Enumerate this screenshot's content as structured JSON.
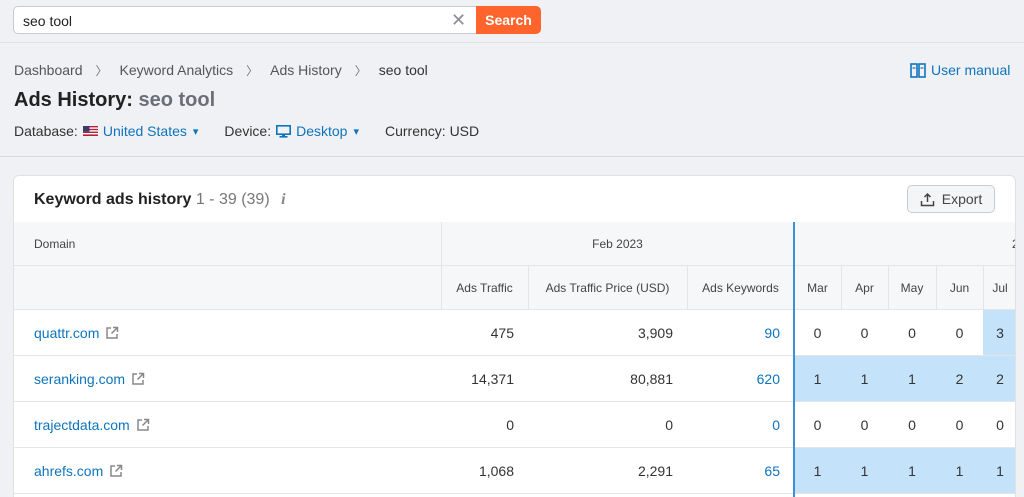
{
  "search": {
    "value": "seo tool",
    "button_label": "Search"
  },
  "breadcrumb": {
    "items": [
      "Dashboard",
      "Keyword Analytics",
      "Ads History"
    ],
    "current": "seo tool"
  },
  "user_manual_label": "User manual",
  "title": {
    "main": "Ads History:",
    "query": "seo tool"
  },
  "filters": {
    "database_label": "Database:",
    "database_value": "United States",
    "device_label": "Device:",
    "device_value": "Desktop",
    "currency_label": "Currency: USD"
  },
  "card": {
    "title": "Keyword ads history",
    "count": "1 - 39 (39)",
    "info_icon": "i",
    "export_label": "Export"
  },
  "table": {
    "domain_header": "Domain",
    "period_header": "Feb 2023",
    "next_period_fragment": "2",
    "columns": [
      "Ads Traffic",
      "Ads Traffic Price (USD)",
      "Ads Keywords"
    ],
    "months": [
      "Mar",
      "Apr",
      "May",
      "Jun",
      "Jul"
    ],
    "rows": [
      {
        "domain": "quattr.com",
        "traffic": "475",
        "price": "3,909",
        "keywords": "90",
        "months": [
          "0",
          "0",
          "0",
          "0",
          "3"
        ],
        "highlight": [
          false,
          false,
          false,
          false,
          true
        ]
      },
      {
        "domain": "seranking.com",
        "traffic": "14,371",
        "price": "80,881",
        "keywords": "620",
        "months": [
          "1",
          "1",
          "1",
          "2",
          "2"
        ],
        "highlight": [
          true,
          true,
          true,
          true,
          true
        ]
      },
      {
        "domain": "trajectdata.com",
        "traffic": "0",
        "price": "0",
        "keywords": "0",
        "months": [
          "0",
          "0",
          "0",
          "0",
          "0"
        ],
        "highlight": [
          false,
          false,
          false,
          false,
          false
        ]
      },
      {
        "domain": "ahrefs.com",
        "traffic": "1,068",
        "price": "2,291",
        "keywords": "65",
        "months": [
          "1",
          "1",
          "1",
          "1",
          "1"
        ],
        "highlight": [
          true,
          true,
          true,
          true,
          true
        ]
      }
    ]
  },
  "colors": {
    "accent": "#ff642d",
    "link": "#0e74bc",
    "highlight_cell": "#c4e3fb"
  }
}
